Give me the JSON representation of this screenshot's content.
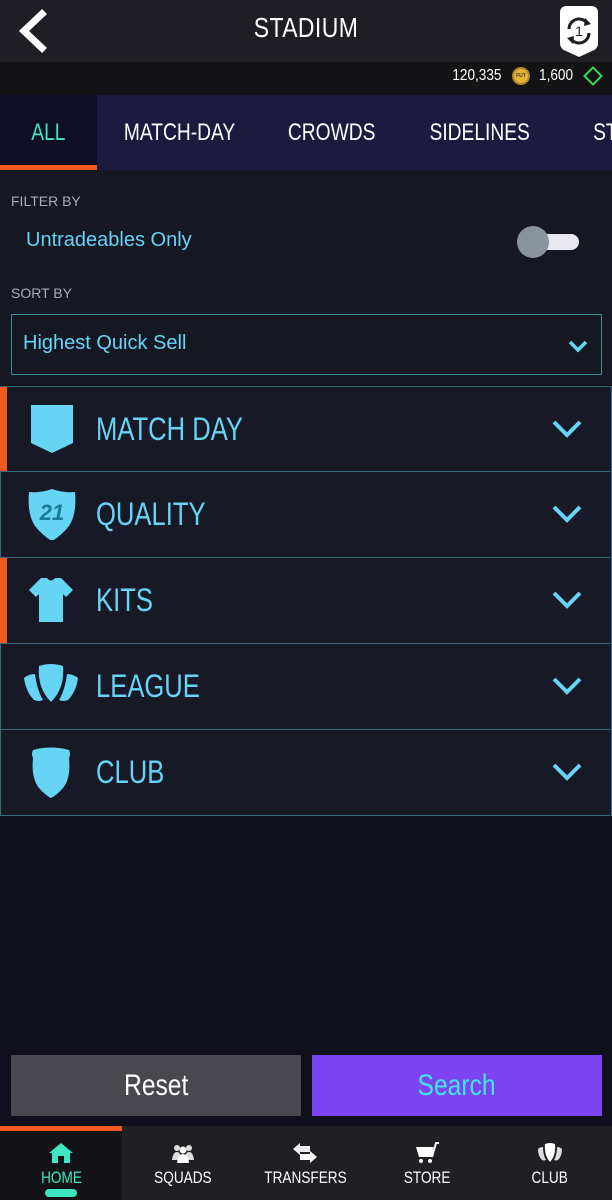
{
  "header": {
    "title": "STADIUM",
    "back_icon": "chevron-left-icon",
    "objectives_icon": "objectives-badge-icon",
    "objectives_count": "1"
  },
  "currency": {
    "coins": "120,335",
    "coins_icon_label": "FUT",
    "points": "1,600"
  },
  "tabs": [
    {
      "label": "ALL",
      "active": true
    },
    {
      "label": "MATCH-DAY",
      "active": false
    },
    {
      "label": "CROWDS",
      "active": false
    },
    {
      "label": "SIDELINES",
      "active": false
    },
    {
      "label": "ST",
      "active": false
    }
  ],
  "filter": {
    "filter_by_label": "FILTER BY",
    "untradeables_label": "Untradeables Only",
    "untradeables_on": false,
    "sort_by_label": "SORT BY",
    "sort_value": "Highest Quick Sell"
  },
  "categories": [
    {
      "label": "MATCH DAY",
      "icon": "pennant-icon",
      "highlighted": true
    },
    {
      "label": "QUALITY",
      "icon": "quality-shield-icon",
      "icon_text": "21",
      "highlighted": false
    },
    {
      "label": "KITS",
      "icon": "shirt-icon",
      "highlighted": true
    },
    {
      "label": "LEAGUE",
      "icon": "league-icon",
      "highlighted": false
    },
    {
      "label": "CLUB",
      "icon": "club-crest-icon",
      "highlighted": false
    }
  ],
  "actions": {
    "reset_label": "Reset",
    "search_label": "Search"
  },
  "nav": [
    {
      "label": "HOME",
      "icon": "home-icon",
      "active": true
    },
    {
      "label": "SQUADS",
      "icon": "squads-icon",
      "active": false
    },
    {
      "label": "TRANSFERS",
      "icon": "transfers-icon",
      "active": false
    },
    {
      "label": "STORE",
      "icon": "cart-icon",
      "active": false
    },
    {
      "label": "CLUB",
      "icon": "club-icon",
      "active": false
    }
  ],
  "colors": {
    "accent_orange": "#f05a1f",
    "accent_teal": "#3ee6c2",
    "text_blue": "#66d4f5",
    "search_purple": "#7b44f0"
  }
}
